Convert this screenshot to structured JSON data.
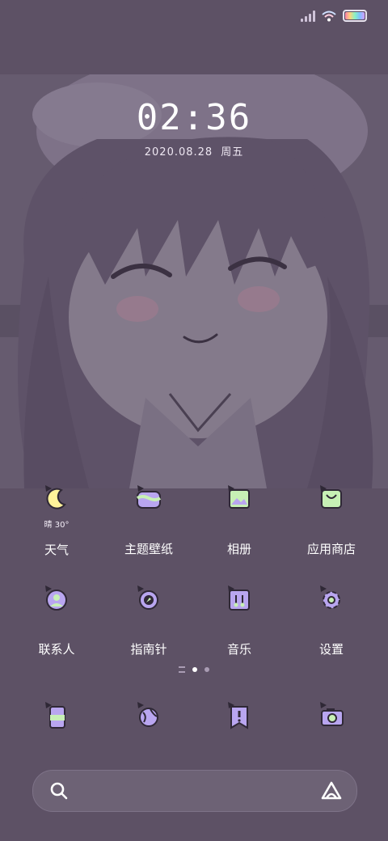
{
  "status_bar": {
    "icons": [
      "signal-icon",
      "wifi-icon",
      "battery-icon"
    ]
  },
  "lock": {
    "time": "02:36",
    "date": "2020.08.28",
    "weekday": "周五"
  },
  "weather": {
    "icon": "moon-icon",
    "text": "晴 30°"
  },
  "apps_row1": [
    {
      "label": "天气",
      "icon": "weather-icon"
    },
    {
      "label": "主题壁纸",
      "icon": "theme-icon"
    },
    {
      "label": "相册",
      "icon": "gallery-icon"
    },
    {
      "label": "应用商店",
      "icon": "app-store-icon"
    }
  ],
  "apps_row2": [
    {
      "label": "联系人",
      "icon": "contacts-icon"
    },
    {
      "label": "指南针",
      "icon": "compass-icon"
    },
    {
      "label": "音乐",
      "icon": "music-icon"
    },
    {
      "label": "设置",
      "icon": "settings-icon"
    }
  ],
  "page_indicator": {
    "total_pages": 2,
    "current": 1
  },
  "dock": [
    {
      "icon": "phone-icon"
    },
    {
      "icon": "browser-icon"
    },
    {
      "icon": "notes-icon"
    },
    {
      "icon": "camera-icon"
    }
  ],
  "search_bar": {
    "left_icon": "search-icon",
    "right_icon": "assistant-icon"
  },
  "colors": {
    "background": "#5d5165",
    "accent_yellow": "#fff39a",
    "accent_purple": "#b9a6f0",
    "accent_green": "#c7f0b5"
  }
}
